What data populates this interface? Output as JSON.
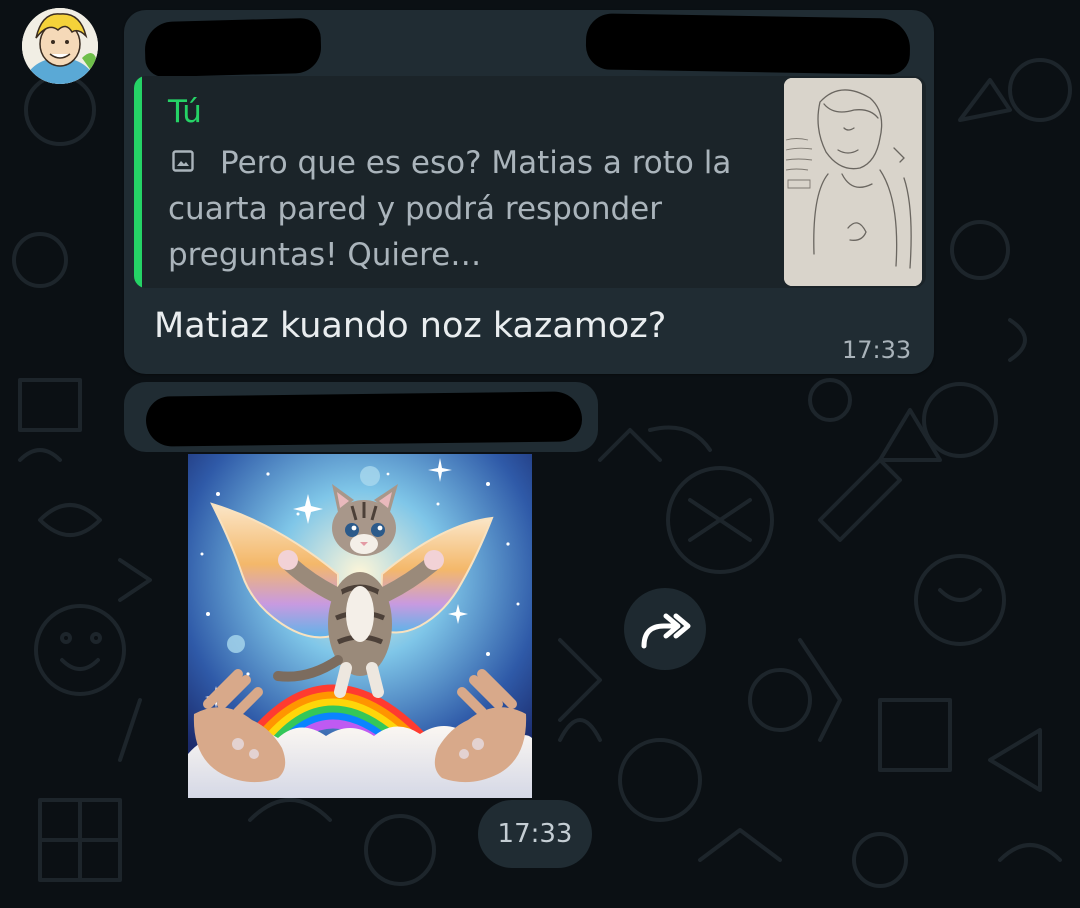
{
  "colors": {
    "background": "#0b1014",
    "bubble": "#202c33",
    "quote_background": "#1b2429",
    "accent": "#25d366",
    "text_primary": "#e9edef",
    "text_secondary": "#aab4bb"
  },
  "chat": {
    "message": {
      "reply_quote": {
        "author": "Tú",
        "icon": "image-icon",
        "text": "Pero que es eso? Matias a roto la cuarta pared y podrá responder preguntas! Quiere…"
      },
      "text": "Matiaz kuando noz kazamoz?",
      "time": "17:33"
    },
    "sticker_message": {
      "time": "17:33",
      "forward_icon": "forward-icon"
    }
  }
}
